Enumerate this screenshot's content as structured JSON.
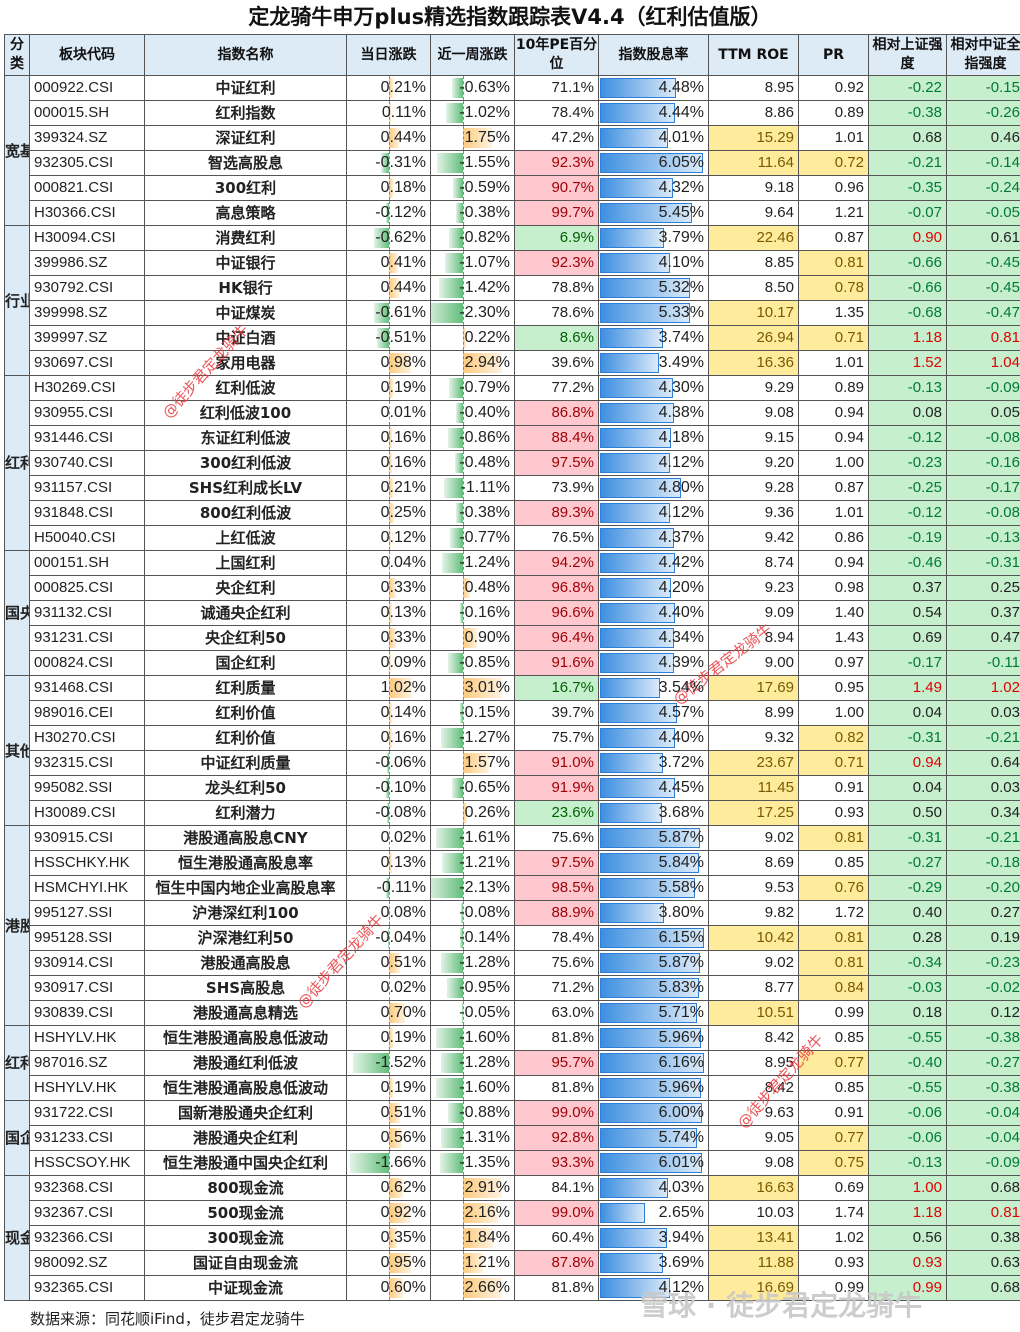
{
  "title": "定龙骑牛申万plus精选指数跟踪表V4.4（红利估值版）",
  "headers": [
    "分类",
    "板块代码",
    "指数名称",
    "当日涨跌",
    "近一周涨跌",
    "10年PE百分位",
    "指数股息率",
    "TTM ROE",
    "PR",
    "相对上证强度",
    "相对中证全指强度"
  ],
  "categories": [
    "宽基红利",
    "行业红利",
    "红利低波",
    "国央企红利",
    "其他红利",
    "港股宽基红利",
    "红利低波",
    "国企",
    "现金流"
  ],
  "rows": [
    {
      "code": "000922.CSI",
      "name": "中证红利",
      "day": "0.21%",
      "week": "-0.63%",
      "pe": "71.1%",
      "dy": "4.48%",
      "roe": "8.95",
      "pr": "0.92",
      "rs": "-0.22",
      "rz": "-0.15"
    },
    {
      "code": "000015.SH",
      "name": "红利指数",
      "day": "0.11%",
      "week": "-1.02%",
      "pe": "78.4%",
      "dy": "4.44%",
      "roe": "8.86",
      "pr": "0.89",
      "rs": "-0.38",
      "rz": "-0.26"
    },
    {
      "code": "399324.SZ",
      "name": "深证红利",
      "day": "0.44%",
      "week": "1.75%",
      "pe": "47.2%",
      "dy": "4.01%",
      "roe": "15.29",
      "pr": "1.01",
      "rs": "0.68",
      "rz": "0.46"
    },
    {
      "code": "932305.CSI",
      "name": "智选高股息",
      "day": "-0.31%",
      "week": "-1.55%",
      "pe": "92.3%",
      "dy": "6.05%",
      "roe": "11.64",
      "pr": "0.72",
      "rs": "-0.21",
      "rz": "-0.14"
    },
    {
      "code": "000821.CSI",
      "name": "300红利",
      "day": "0.18%",
      "week": "-0.59%",
      "pe": "90.7%",
      "dy": "4.32%",
      "roe": "9.18",
      "pr": "0.96",
      "rs": "-0.35",
      "rz": "-0.24"
    },
    {
      "code": "H30366.CSI",
      "name": "高息策略",
      "day": "-0.12%",
      "week": "-0.38%",
      "pe": "99.7%",
      "dy": "5.45%",
      "roe": "9.64",
      "pr": "1.21",
      "rs": "-0.07",
      "rz": "-0.05"
    },
    {
      "code": "H30094.CSI",
      "name": "消费红利",
      "day": "-0.62%",
      "week": "-0.82%",
      "pe": "6.9%",
      "dy": "3.79%",
      "roe": "22.46",
      "pr": "0.87",
      "rs": "0.90",
      "rz": "0.61"
    },
    {
      "code": "399986.SZ",
      "name": "中证银行",
      "day": "0.41%",
      "week": "-1.07%",
      "pe": "92.3%",
      "dy": "4.10%",
      "roe": "8.85",
      "pr": "0.81",
      "rs": "-0.66",
      "rz": "-0.45"
    },
    {
      "code": "930792.CSI",
      "name": "HK银行",
      "day": "0.44%",
      "week": "-1.42%",
      "pe": "78.8%",
      "dy": "5.32%",
      "roe": "8.50",
      "pr": "0.78",
      "rs": "-0.66",
      "rz": "-0.45"
    },
    {
      "code": "399998.SZ",
      "name": "中证煤炭",
      "day": "-0.61%",
      "week": "-2.30%",
      "pe": "78.6%",
      "dy": "5.33%",
      "roe": "10.17",
      "pr": "1.35",
      "rs": "-0.68",
      "rz": "-0.47"
    },
    {
      "code": "399997.SZ",
      "name": "中证白酒",
      "day": "-0.51%",
      "week": "0.22%",
      "pe": "8.6%",
      "dy": "3.74%",
      "roe": "26.94",
      "pr": "0.71",
      "rs": "1.18",
      "rz": "0.81"
    },
    {
      "code": "930697.CSI",
      "name": "家用电器",
      "day": "0.98%",
      "week": "2.94%",
      "pe": "39.6%",
      "dy": "3.49%",
      "roe": "16.36",
      "pr": "1.01",
      "rs": "1.52",
      "rz": "1.04"
    },
    {
      "code": "H30269.CSI",
      "name": "红利低波",
      "day": "0.19%",
      "week": "-0.79%",
      "pe": "77.2%",
      "dy": "4.30%",
      "roe": "9.29",
      "pr": "0.89",
      "rs": "-0.13",
      "rz": "-0.09"
    },
    {
      "code": "930955.CSI",
      "name": "红利低波100",
      "day": "0.01%",
      "week": "-0.40%",
      "pe": "86.8%",
      "dy": "4.38%",
      "roe": "9.08",
      "pr": "0.94",
      "rs": "0.08",
      "rz": "0.05"
    },
    {
      "code": "931446.CSI",
      "name": "东证红利低波",
      "day": "0.16%",
      "week": "-0.86%",
      "pe": "88.4%",
      "dy": "4.18%",
      "roe": "9.15",
      "pr": "0.94",
      "rs": "-0.12",
      "rz": "-0.08"
    },
    {
      "code": "930740.CSI",
      "name": "300红利低波",
      "day": "0.16%",
      "week": "-0.48%",
      "pe": "97.5%",
      "dy": "4.12%",
      "roe": "9.20",
      "pr": "1.00",
      "rs": "-0.23",
      "rz": "-0.16"
    },
    {
      "code": "931157.CSI",
      "name": "SHS红利成长LV",
      "day": "0.21%",
      "week": "-1.11%",
      "pe": "73.9%",
      "dy": "4.80%",
      "roe": "9.28",
      "pr": "0.87",
      "rs": "-0.25",
      "rz": "-0.17"
    },
    {
      "code": "931848.CSI",
      "name": "800红利低波",
      "day": "0.25%",
      "week": "-0.38%",
      "pe": "89.3%",
      "dy": "4.12%",
      "roe": "9.36",
      "pr": "1.01",
      "rs": "-0.12",
      "rz": "-0.08"
    },
    {
      "code": "H50040.CSI",
      "name": "上红低波",
      "day": "0.12%",
      "week": "-0.77%",
      "pe": "76.5%",
      "dy": "4.37%",
      "roe": "9.42",
      "pr": "0.86",
      "rs": "-0.19",
      "rz": "-0.13"
    },
    {
      "code": "000151.SH",
      "name": "上国红利",
      "day": "0.04%",
      "week": "-1.24%",
      "pe": "94.2%",
      "dy": "4.42%",
      "roe": "8.74",
      "pr": "0.94",
      "rs": "-0.46",
      "rz": "-0.31"
    },
    {
      "code": "000825.CSI",
      "name": "央企红利",
      "day": "0.33%",
      "week": "0.48%",
      "pe": "96.8%",
      "dy": "4.20%",
      "roe": "9.23",
      "pr": "0.98",
      "rs": "0.37",
      "rz": "0.25"
    },
    {
      "code": "931132.CSI",
      "name": "诚通央企红利",
      "day": "0.13%",
      "week": "-0.16%",
      "pe": "96.6%",
      "dy": "4.40%",
      "roe": "9.09",
      "pr": "1.40",
      "rs": "0.54",
      "rz": "0.37"
    },
    {
      "code": "931231.CSI",
      "name": "央企红利50",
      "day": "0.33%",
      "week": "0.90%",
      "pe": "96.4%",
      "dy": "4.34%",
      "roe": "8.94",
      "pr": "1.43",
      "rs": "0.69",
      "rz": "0.47"
    },
    {
      "code": "000824.CSI",
      "name": "国企红利",
      "day": "0.09%",
      "week": "-0.85%",
      "pe": "91.6%",
      "dy": "4.39%",
      "roe": "9.00",
      "pr": "0.97",
      "rs": "-0.17",
      "rz": "-0.11"
    },
    {
      "code": "931468.CSI",
      "name": "红利质量",
      "day": "1.02%",
      "week": "3.01%",
      "pe": "16.7%",
      "dy": "3.54%",
      "roe": "17.69",
      "pr": "0.95",
      "rs": "1.49",
      "rz": "1.02"
    },
    {
      "code": "989016.CEI",
      "name": "红利价值",
      "day": "0.14%",
      "week": "-0.15%",
      "pe": "39.7%",
      "dy": "4.57%",
      "roe": "8.99",
      "pr": "1.00",
      "rs": "0.04",
      "rz": "0.03"
    },
    {
      "code": "H30270.CSI",
      "name": "红利价值",
      "day": "0.16%",
      "week": "-1.27%",
      "pe": "75.7%",
      "dy": "4.40%",
      "roe": "9.32",
      "pr": "0.82",
      "rs": "-0.31",
      "rz": "-0.21"
    },
    {
      "code": "932315.CSI",
      "name": "中证红利质量",
      "day": "-0.06%",
      "week": "1.57%",
      "pe": "91.0%",
      "dy": "3.72%",
      "roe": "23.67",
      "pr": "0.71",
      "rs": "0.94",
      "rz": "0.64"
    },
    {
      "code": "995082.SSI",
      "name": "龙头红利50",
      "day": "-0.10%",
      "week": "-0.65%",
      "pe": "91.9%",
      "dy": "4.45%",
      "roe": "11.45",
      "pr": "0.91",
      "rs": "0.04",
      "rz": "0.03"
    },
    {
      "code": "H30089.CSI",
      "name": "红利潜力",
      "day": "-0.08%",
      "week": "0.26%",
      "pe": "23.6%",
      "dy": "3.68%",
      "roe": "17.25",
      "pr": "0.93",
      "rs": "0.50",
      "rz": "0.34"
    },
    {
      "code": "930915.CSI",
      "name": "港股通高股息CNY",
      "day": "0.02%",
      "week": "-1.61%",
      "pe": "75.6%",
      "dy": "5.87%",
      "roe": "9.02",
      "pr": "0.81",
      "rs": "-0.31",
      "rz": "-0.21"
    },
    {
      "code": "HSSCHKY.HK",
      "name": "恒生港股通高股息率",
      "day": "0.13%",
      "week": "-1.21%",
      "pe": "97.5%",
      "dy": "5.84%",
      "roe": "8.69",
      "pr": "0.85",
      "rs": "-0.27",
      "rz": "-0.18"
    },
    {
      "code": "HSMCHYI.HK",
      "name": "恒生中国内地企业高股息率",
      "day": "-0.11%",
      "week": "-2.13%",
      "pe": "98.5%",
      "dy": "5.58%",
      "roe": "9.53",
      "pr": "0.76",
      "rs": "-0.29",
      "rz": "-0.20"
    },
    {
      "code": "995127.SSI",
      "name": "沪港深红利100",
      "day": "0.08%",
      "week": "-0.08%",
      "pe": "88.9%",
      "dy": "3.80%",
      "roe": "9.82",
      "pr": "1.72",
      "rs": "0.40",
      "rz": "0.27"
    },
    {
      "code": "995128.SSI",
      "name": "沪深港红利50",
      "day": "-0.04%",
      "week": "-0.14%",
      "pe": "78.4%",
      "dy": "6.15%",
      "roe": "10.42",
      "pr": "0.81",
      "rs": "0.28",
      "rz": "0.19"
    },
    {
      "code": "930914.CSI",
      "name": "港股通高股息",
      "day": "0.51%",
      "week": "-1.28%",
      "pe": "75.6%",
      "dy": "5.87%",
      "roe": "9.02",
      "pr": "0.81",
      "rs": "-0.34",
      "rz": "-0.23"
    },
    {
      "code": "930917.CSI",
      "name": "SHS高股息",
      "day": "0.02%",
      "week": "-0.95%",
      "pe": "71.2%",
      "dy": "5.83%",
      "roe": "8.77",
      "pr": "0.84",
      "rs": "-0.03",
      "rz": "-0.02"
    },
    {
      "code": "930839.CSI",
      "name": "港股通高息精选",
      "day": "0.70%",
      "week": "-0.05%",
      "pe": "63.0%",
      "dy": "5.71%",
      "roe": "10.51",
      "pr": "0.99",
      "rs": "0.18",
      "rz": "0.12"
    },
    {
      "code": "HSHYLV.HK",
      "name": "恒生港股通高股息低波动",
      "day": "0.19%",
      "week": "-1.60%",
      "pe": "81.8%",
      "dy": "5.96%",
      "roe": "8.42",
      "pr": "0.85",
      "rs": "-0.55",
      "rz": "-0.38"
    },
    {
      "code": "987016.SZ",
      "name": "港股通红利低波",
      "day": "-1.52%",
      "week": "-1.28%",
      "pe": "95.7%",
      "dy": "6.16%",
      "roe": "8.95",
      "pr": "0.77",
      "rs": "-0.40",
      "rz": "-0.27"
    },
    {
      "code": "HSHYLV.HK",
      "name": "恒生港股通高股息低波动",
      "day": "0.19%",
      "week": "-1.60%",
      "pe": "81.8%",
      "dy": "5.96%",
      "roe": "8.42",
      "pr": "0.85",
      "rs": "-0.55",
      "rz": "-0.38"
    },
    {
      "code": "931722.CSI",
      "name": "国新港股通央企红利",
      "day": "0.51%",
      "week": "-0.88%",
      "pe": "99.0%",
      "dy": "6.00%",
      "roe": "9.63",
      "pr": "0.91",
      "rs": "-0.06",
      "rz": "-0.04"
    },
    {
      "code": "931233.CSI",
      "name": "港股通央企红利",
      "day": "0.56%",
      "week": "-1.31%",
      "pe": "92.8%",
      "dy": "5.74%",
      "roe": "9.05",
      "pr": "0.77",
      "rs": "-0.06",
      "rz": "-0.04"
    },
    {
      "code": "HSSCSOY.HK",
      "name": "恒生港股通中国央企红利",
      "day": "-1.66%",
      "week": "-1.35%",
      "pe": "93.3%",
      "dy": "6.01%",
      "roe": "9.08",
      "pr": "0.75",
      "rs": "-0.13",
      "rz": "-0.09"
    },
    {
      "code": "932368.CSI",
      "name": "800现金流",
      "day": "0.62%",
      "week": "2.91%",
      "pe": "84.1%",
      "dy": "4.03%",
      "roe": "16.63",
      "pr": "0.69",
      "rs": "1.00",
      "rz": "0.68"
    },
    {
      "code": "932367.CSI",
      "name": "500现金流",
      "day": "0.92%",
      "week": "2.16%",
      "pe": "99.0%",
      "dy": "2.65%",
      "roe": "10.03",
      "pr": "1.74",
      "rs": "1.18",
      "rz": "0.81"
    },
    {
      "code": "932366.CSI",
      "name": "300现金流",
      "day": "0.35%",
      "week": "1.84%",
      "pe": "60.4%",
      "dy": "3.94%",
      "roe": "13.41",
      "pr": "1.02",
      "rs": "0.56",
      "rz": "0.38"
    },
    {
      "code": "980092.SZ",
      "name": "国证自由现金流",
      "day": "0.95%",
      "week": "1.21%",
      "pe": "87.8%",
      "dy": "3.69%",
      "roe": "11.88",
      "pr": "0.93",
      "rs": "0.93",
      "rz": "0.63"
    },
    {
      "code": "932365.CSI",
      "name": "中证现金流",
      "day": "0.60%",
      "week": "2.66%",
      "pe": "81.8%",
      "dy": "4.12%",
      "roe": "16.69",
      "pr": "0.99",
      "rs": "0.99",
      "rz": "0.68"
    }
  ],
  "footer": "数据来源：同花顺iFind，徒步君定龙骑牛",
  "watermark": "@徒步君定龙骑牛",
  "brand": "雪球 · 徒步君定龙骑牛",
  "colors": {
    "pos_fill": "#fdca7c",
    "neg_fill": "#63be7b",
    "dy_fill": "#3d8fe0",
    "red_cell": "#ffc7ce",
    "green_cell": "#c6efce",
    "yellow_cell": "#ffeb9c",
    "header_bg": "#ddebf7"
  }
}
